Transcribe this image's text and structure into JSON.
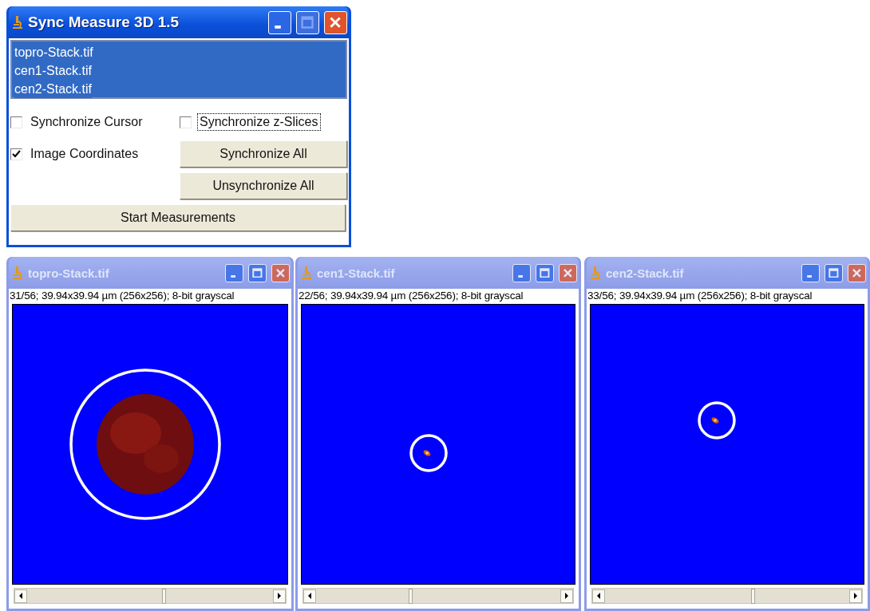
{
  "dialog": {
    "title": "Sync Measure 3D 1.5",
    "active": true,
    "files": [
      {
        "name": "topro-Stack.tif",
        "selected": true
      },
      {
        "name": "cen1-Stack.tif",
        "selected": true
      },
      {
        "name": "cen2-Stack.tif",
        "selected": true
      }
    ],
    "options": [
      {
        "kind": "checkbox",
        "label": "Synchronize Cursor",
        "checked": false,
        "focused": false
      },
      {
        "kind": "checkbox",
        "label": "Synchronize z-Slices",
        "checked": false,
        "focused": true
      },
      {
        "kind": "checkbox",
        "label": "Image Coordinates",
        "checked": true,
        "focused": false
      },
      {
        "kind": "button",
        "label": "Synchronize All"
      },
      {
        "kind": "button",
        "label": "Unsynchronize All"
      }
    ],
    "start_button": "Start Measurements"
  },
  "image_windows": [
    {
      "title": "topro-Stack.tif",
      "active": false,
      "info": "31/56; 39.94x39.94 µm (256x256); 8-bit grayscal"
    },
    {
      "title": "cen1-Stack.tif",
      "active": false,
      "info": "22/56; 39.94x39.94 µm (256x256); 8-bit grayscal"
    },
    {
      "title": "cen2-Stack.tif",
      "active": false,
      "info": "33/56; 39.94x39.94 µm (256x256); 8-bit grayscal"
    }
  ]
}
